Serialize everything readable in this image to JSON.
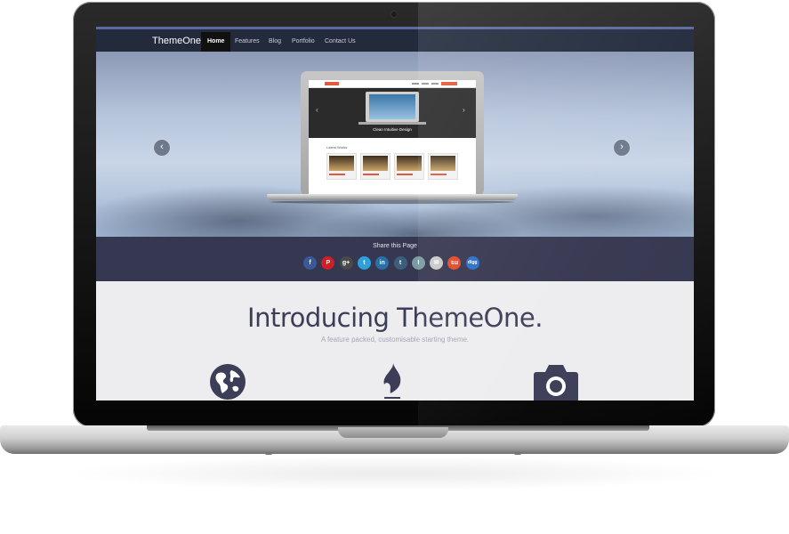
{
  "site": {
    "brand": "ThemeOne",
    "nav": [
      "Home",
      "Features",
      "Blog",
      "Portfolio",
      "Contact Us"
    ],
    "active_nav": "Home"
  },
  "hero": {
    "prev_icon": "chevron-left-icon",
    "next_icon": "chevron-right-icon",
    "prev_glyph": "‹",
    "next_glyph": "›",
    "preview": {
      "caption": "Clean Intuitive Design",
      "section_label": "Latest Works"
    }
  },
  "share": {
    "title": "Share this Page",
    "icons": [
      {
        "name": "facebook-icon",
        "glyph": "f",
        "color": "#3b5998"
      },
      {
        "name": "pinterest-icon",
        "glyph": "P",
        "color": "#cb2027"
      },
      {
        "name": "google-plus-icon",
        "glyph": "g+",
        "color": "#4a4a4a"
      },
      {
        "name": "twitter-icon",
        "glyph": "t",
        "color": "#2fa0d9"
      },
      {
        "name": "linkedin-icon",
        "glyph": "in",
        "color": "#2a6fa8"
      },
      {
        "name": "tumblr-icon",
        "glyph": "t",
        "color": "#3b5f7a"
      },
      {
        "name": "instapaper-icon",
        "glyph": "I",
        "color": "#7a9aa4"
      },
      {
        "name": "email-icon",
        "glyph": "✉",
        "color": "#c9c9c9"
      },
      {
        "name": "stumbleupon-icon",
        "glyph": "su",
        "color": "#e4492a"
      },
      {
        "name": "digg-icon",
        "glyph": "digg",
        "color": "#2b6fc7"
      }
    ]
  },
  "intro": {
    "title": "Introducing ThemeOne.",
    "subtitle": "A feature packed, customisable starting theme."
  },
  "features": {
    "icons": [
      "globe-icon",
      "flame-icon",
      "camera-icon"
    ]
  },
  "colors": {
    "navbar": "#222a3c",
    "share_band": "#363750",
    "intro_title": "#3c3d57",
    "accent": "#e15a3c"
  }
}
